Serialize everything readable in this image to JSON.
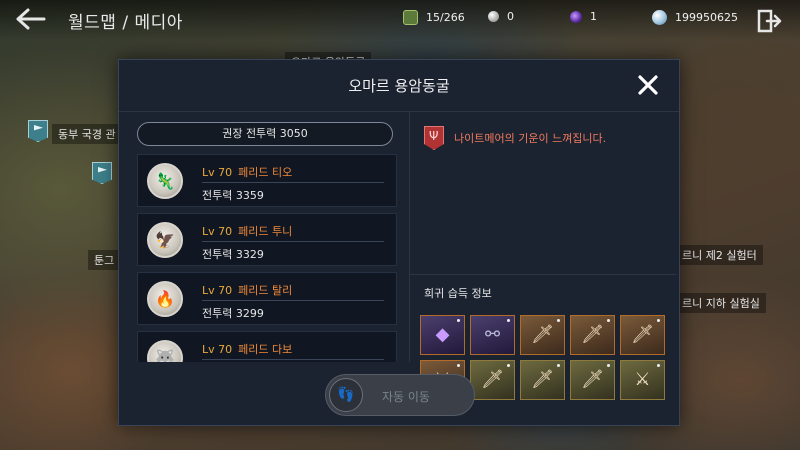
{
  "header": {
    "title": "월드맵 / 메디아"
  },
  "resources": {
    "stamina": "15/266",
    "pearl": "0",
    "orb": "1",
    "silver": "199950625"
  },
  "map_labels": [
    {
      "text": "오마르 용암동굴"
    },
    {
      "text": "동부 국경 관"
    },
    {
      "text": "툰그"
    },
    {
      "text": "르니 제2 실험터"
    },
    {
      "text": "르니 지하 실험실"
    }
  ],
  "dialog": {
    "title": "오마르 용암동굴",
    "recommended_power": "권장 전투력 3050",
    "warning": "나이트메어의 기운이 느껴집니다.",
    "rare_title": "희귀 습득 정보",
    "auto_move_label": "자동 이동",
    "bosses": [
      {
        "level": "Lv 70",
        "name": "페리드 티오",
        "power": "전투력 3359",
        "glyph": "🦎"
      },
      {
        "level": "Lv 70",
        "name": "페리드 투니",
        "power": "전투력 3329",
        "glyph": "🦅"
      },
      {
        "level": "Lv 70",
        "name": "페리드 탈리",
        "power": "전투력 3299",
        "glyph": "🔥"
      },
      {
        "level": "Lv 70",
        "name": "페리드 다보",
        "power": "",
        "glyph": "🐺"
      }
    ],
    "rare_items": [
      {
        "icon": "crystal-icon",
        "glyph": "◆"
      },
      {
        "icon": "necklace-icon",
        "glyph": "⚯"
      },
      {
        "icon": "dagger-icon",
        "glyph": "🗡"
      },
      {
        "icon": "dagger-icon",
        "glyph": "🗡"
      },
      {
        "icon": "dagger-icon",
        "glyph": "🗡"
      },
      {
        "icon": "sword-icon",
        "glyph": "⚔"
      },
      {
        "icon": "dagger-icon",
        "glyph": "🗡"
      },
      {
        "icon": "dagger-icon",
        "glyph": "🗡"
      },
      {
        "icon": "dagger-icon",
        "glyph": "🗡"
      },
      {
        "icon": "sword-icon",
        "glyph": "⚔"
      }
    ]
  },
  "colors": {
    "accent_orange": "#f08a3a",
    "warning_red": "#f07a5c",
    "dialog_bg": "#1b2230"
  }
}
